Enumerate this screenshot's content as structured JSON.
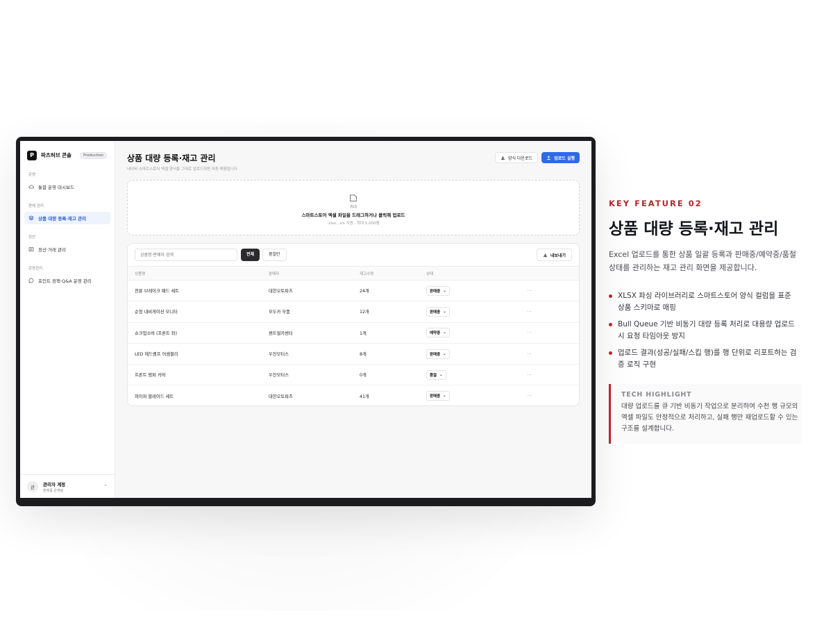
{
  "brand": {
    "logo": "P",
    "name": "파츠허브 콘솔",
    "badge": "Production"
  },
  "sidebar": {
    "sections": [
      {
        "label": "운영",
        "items": [
          {
            "label": "통합 운영 대시보드",
            "icon": "cloud-icon"
          }
        ]
      },
      {
        "label": "판매 관리",
        "items": [
          {
            "label": "상품 대량 등록·재고 관리",
            "icon": "layers-icon",
            "active": true
          }
        ]
      },
      {
        "label": "정산",
        "items": [
          {
            "label": "정산·거래 관리",
            "icon": "receipt-icon"
          }
        ]
      },
      {
        "label": "운영관리",
        "items": [
          {
            "label": "포인트 정책·Q&A 운영 관리",
            "icon": "chat-icon"
          }
        ]
      }
    ],
    "account": {
      "avatar": "관",
      "name": "관리자 계정",
      "sub": "플랫폼 운영팀"
    }
  },
  "header": {
    "title": "상품 대량 등록·재고 관리",
    "subtitle": "네이버 스마트스토어 엑셀 양식을 그대로 업로드하면 자동 매핑됩니다",
    "template_button": "양식 다운로드",
    "upload_button": "업로드 실행"
  },
  "dropzone": {
    "icon_text": "XLS",
    "title": "스마트스토어 엑셀 파일을 드래그하거나 클릭해 업로드",
    "hint": ".xlsx, .xls 지원 · 최대 5,000행"
  },
  "toolbar": {
    "search_placeholder": "상품명·판매자 검색",
    "filter_all": "전체",
    "filter_soldout": "품절만",
    "export_button": "내보내기"
  },
  "table": {
    "columns": [
      "상품명",
      "판매자",
      "재고수량",
      "상태"
    ],
    "rows": [
      {
        "name": "전륜 브레이크 패드 세트",
        "seller": "대한오토파츠",
        "stock": "24개",
        "status": "판매중"
      },
      {
        "name": "순정 내비게이션 모니터",
        "seller": "모두카 부품",
        "stock": "12개",
        "status": "판매중"
      },
      {
        "name": "쇼크업소버 (프론트 좌)",
        "seller": "센트럴카센터",
        "stock": "1개",
        "status": "예약중"
      },
      {
        "name": "LED 헤드램프 어셈블리",
        "seller": "우진모터스",
        "stock": "8개",
        "status": "판매중"
      },
      {
        "name": "프론트 범퍼 커버",
        "seller": "우진모터스",
        "stock": "0개",
        "status": "품절"
      },
      {
        "name": "와이퍼 블레이드 세트",
        "seller": "대한오토파츠",
        "stock": "41개",
        "status": "판매중"
      }
    ],
    "more": "···"
  },
  "feature": {
    "label": "KEY FEATURE 02",
    "title": "상품 대량 등록·재고 관리",
    "description": "Excel 업로드를 통한 상품 일괄 등록과 판매중/예약중/품절 상태를 관리하는 재고 관리 화면을 제공합니다.",
    "bullets": [
      "XLSX 파싱 라이브러리로 스마트스토어 양식 컬럼을 표준 상품 스키마로 매핑",
      "Bull Queue 기반 비동기 대량 등록 처리로 대용량 업로드 시 요청 타임아웃 방지",
      "업로드 결과(성공/실패/스킵 행)를 행 단위로 리포트하는 검증 로직 구현"
    ],
    "highlight_title": "TECH HIGHLIGHT",
    "highlight_body": "대량 업로드를 큐 기반 비동기 작업으로 분리하여 수천 행 규모의 엑셀 파일도 안정적으로 처리하고, 실패 행만 재업로드할 수 있는 구조를 설계합니다."
  },
  "colors": {
    "accent": "#b5262c",
    "primary": "#2f6ae5",
    "active_bg": "#eef3fd"
  }
}
